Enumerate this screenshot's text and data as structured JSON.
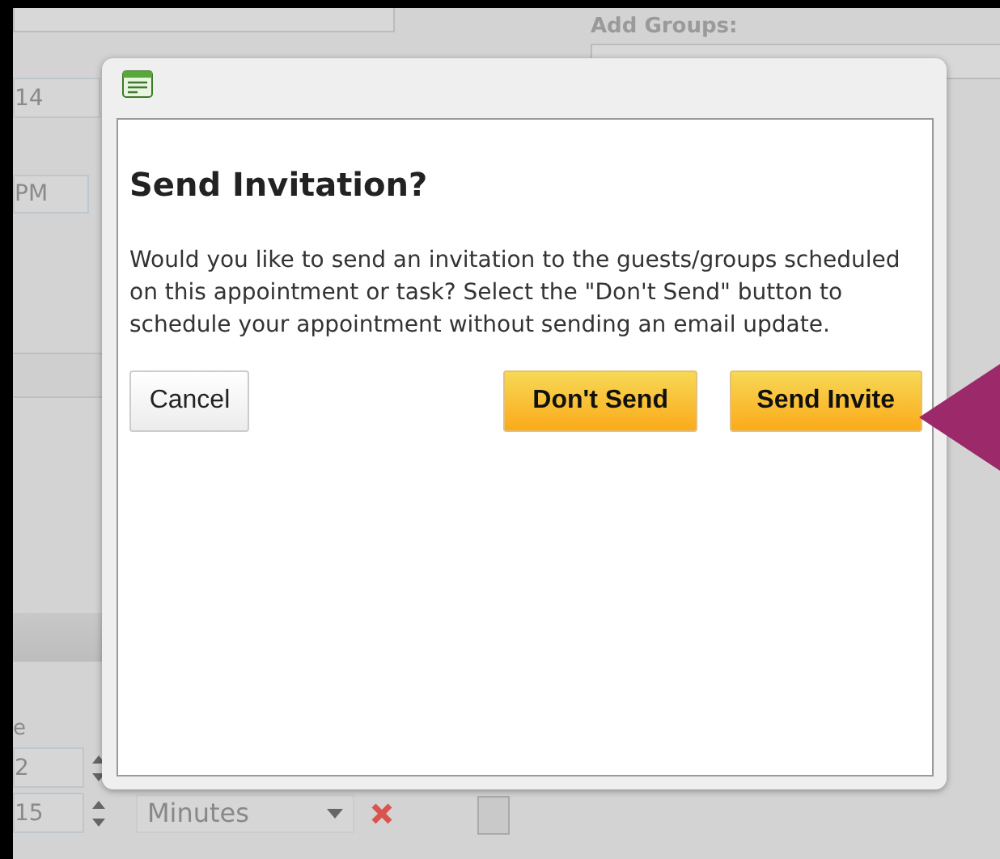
{
  "background": {
    "date_field": {
      "value": "14"
    },
    "time_field": {
      "value": "PM"
    },
    "reminder_label": "e",
    "reminder_fields": [
      {
        "value": "2"
      },
      {
        "value": "15"
      }
    ],
    "unit_dropdown": {
      "value": "Minutes"
    },
    "add_groups_label": "Add Groups:"
  },
  "dialog": {
    "title": "Send Invitation?",
    "message": "Would you like to send an invitation to the guests/groups scheduled on this appointment or task? Select the \"Don't Send\" button to schedule your appointment without sending an email update.",
    "buttons": [
      {
        "label": "Cancel",
        "kind": "secondary"
      },
      {
        "label": "Don't Send",
        "kind": "primary"
      },
      {
        "label": "Send Invite",
        "kind": "primary"
      }
    ]
  }
}
